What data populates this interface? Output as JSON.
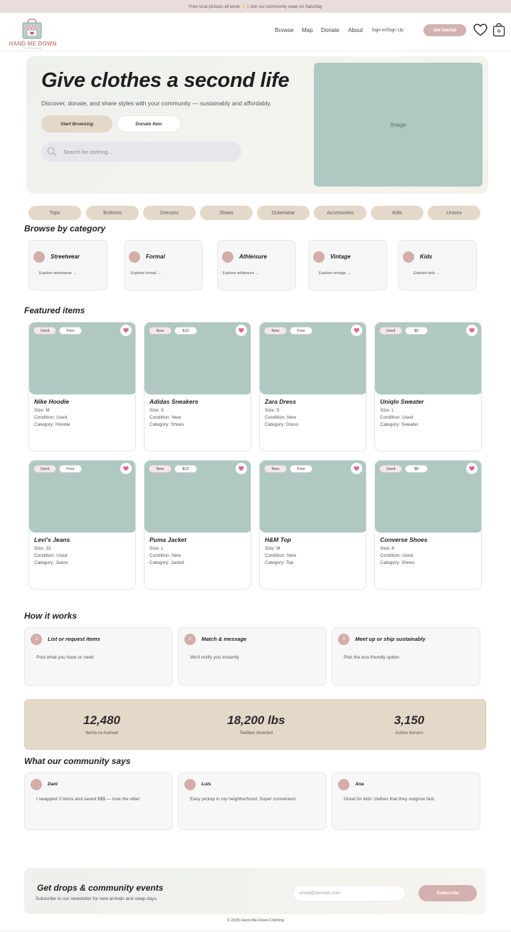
{
  "announcement": "Free local pickups all week ✨ | Join our community swap on Saturday",
  "brand": {
    "name": "HAND ME DOWN",
    "tagline": "CLOTHING"
  },
  "nav": {
    "links": [
      "Browse",
      "Map",
      "Donate",
      "About"
    ],
    "auth": "Sign in/Sign Up",
    "cta": "Get Started",
    "icons": [
      "heart-icon",
      "shopping-bag-icon"
    ]
  },
  "hero": {
    "title": "Give clothes a second life",
    "subtitle": "Discover, donate, and share styles with your community — sustainably and affordably.",
    "primary_button": "Start Browsing",
    "secondary_button": "Donate Item",
    "search_placeholder": "Search for clothing...",
    "image_label": "Image"
  },
  "filters": [
    "Tops",
    "Bottoms",
    "Dresses",
    "Shoes",
    "Outerwear",
    "Accessories",
    "Kids",
    "Unisex"
  ],
  "categories": {
    "title": "Browse by category",
    "items": [
      {
        "name": "Streetwear",
        "link": "Explore streetwear →"
      },
      {
        "name": "Formal",
        "link": "Explore formal →"
      },
      {
        "name": "Athleisure",
        "link": "Explore athleisure →"
      },
      {
        "name": "Vintage",
        "link": "Explore vintage →"
      },
      {
        "name": "Kids",
        "link": "Explore kids →"
      }
    ]
  },
  "featured": {
    "title": "Featured items",
    "items": [
      {
        "condition_tag": "Used",
        "price_tag": "Free",
        "name": "Nike Hoodie",
        "size": "Size: M",
        "condition": "Condition: Used",
        "category": "Category: Hoodie"
      },
      {
        "condition_tag": "New",
        "price_tag": "$10",
        "name": "Adidas Sneakers",
        "size": "Size: 9",
        "condition": "Condition: New",
        "category": "Category: Shoes"
      },
      {
        "condition_tag": "New",
        "price_tag": "Free",
        "name": "Zara Dress",
        "size": "Size: S",
        "condition": "Condition: New",
        "category": "Category: Dress"
      },
      {
        "condition_tag": "Used",
        "price_tag": "$5",
        "name": "Uniqlo Sweater",
        "size": "Size: L",
        "condition": "Condition: Used",
        "category": "Category: Sweater"
      },
      {
        "condition_tag": "Used",
        "price_tag": "Free",
        "name": "Levi's Jeans",
        "size": "Size: 32",
        "condition": "Condition: Used",
        "category": "Category: Jeans"
      },
      {
        "condition_tag": "New",
        "price_tag": "$12",
        "name": "Puma Jacket",
        "size": "Size: L",
        "condition": "Condition: New",
        "category": "Category: Jacket"
      },
      {
        "condition_tag": "New",
        "price_tag": "Free",
        "name": "H&M Top",
        "size": "Size: M",
        "condition": "Condition: New",
        "category": "Category: Top"
      },
      {
        "condition_tag": "Used",
        "price_tag": "$8",
        "name": "Converse Shoes",
        "size": "Size: 8",
        "condition": "Condition: Used",
        "category": "Category: Shoes"
      }
    ]
  },
  "how_it_works": {
    "title": "How it works",
    "steps": [
      {
        "num": "1",
        "title": "List or request items",
        "desc": "Post what you have or need"
      },
      {
        "num": "2",
        "title": "Match & message",
        "desc": "We'll notify you instantly"
      },
      {
        "num": "3",
        "title": "Meet up or ship sustainably",
        "desc": "Pick the eco-friendly option"
      }
    ]
  },
  "stats": [
    {
      "value": "12,480",
      "label": "Items re-homed"
    },
    {
      "value": "18,200 lbs",
      "label": "Textiles diverted"
    },
    {
      "value": "3,150",
      "label": "Active donors"
    }
  ],
  "testimonials": {
    "title": "What our community says",
    "items": [
      {
        "name": "Dani",
        "quote": "I swapped 3 items and saved $$$ — love the vibe!"
      },
      {
        "name": "Luis",
        "quote": "Easy pickup in my neighborhood. Super convenient."
      },
      {
        "name": "Ana",
        "quote": "Great for kids' clothes that they outgrow fast."
      }
    ]
  },
  "newsletter": {
    "title": "Get drops & community events",
    "subtitle": "Subscribe to our newsletter for new arrivals and swap days.",
    "placeholder": "email@domain.com",
    "button": "Subscribe"
  },
  "footer": "© 2025 Hand-Me-Down-Clothing",
  "colors": {
    "accent": "#d4b1b1",
    "sage": "#afc8c1",
    "sand": "#e4d9c8",
    "heart": "#e0648c"
  }
}
